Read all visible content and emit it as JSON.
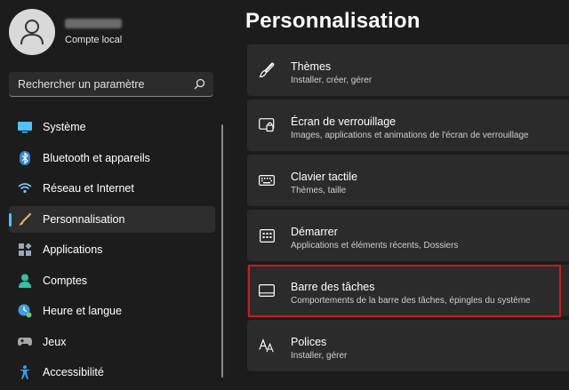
{
  "account": {
    "type": "Compte local"
  },
  "search": {
    "placeholder": "Rechercher un paramètre"
  },
  "nav": [
    {
      "label": "Système",
      "icon": "monitor-icon",
      "color": "#4cc2ff"
    },
    {
      "label": "Bluetooth et appareils",
      "icon": "bluetooth-icon",
      "color": "#2b88d8"
    },
    {
      "label": "Réseau et Internet",
      "icon": "wifi-icon",
      "color": "#7fc6f2"
    },
    {
      "label": "Personnalisation",
      "icon": "brush-icon",
      "color": "#f2a65a",
      "active": true
    },
    {
      "label": "Applications",
      "icon": "apps-icon",
      "color": "#9aa7b8"
    },
    {
      "label": "Comptes",
      "icon": "accounts-icon",
      "color": "#2ec4a5"
    },
    {
      "label": "Heure et langue",
      "icon": "clock-globe-icon",
      "color": "#3b9de6"
    },
    {
      "label": "Jeux",
      "icon": "gamepad-icon",
      "color": "#a8a8a8"
    },
    {
      "label": "Accessibilité",
      "icon": "accessibility-icon",
      "color": "#3aa0e8"
    }
  ],
  "page": {
    "title": "Personnalisation"
  },
  "cards": [
    {
      "title": "Thèmes",
      "subtitle": "Installer, créer, gérer",
      "icon": "brush-icon"
    },
    {
      "title": "Écran de verrouillage",
      "subtitle": "Images, applications et animations de l'écran de verrouillage",
      "icon": "lock-screen-icon"
    },
    {
      "title": "Clavier tactile",
      "subtitle": "Thèmes, taille",
      "icon": "keyboard-icon"
    },
    {
      "title": "Démarrer",
      "subtitle": "Applications et éléments récents, Dossiers",
      "icon": "start-icon"
    },
    {
      "title": "Barre des tâches",
      "subtitle": "Comportements de la barre des tâches, épingles du système",
      "icon": "taskbar-icon",
      "highlighted": true
    },
    {
      "title": "Polices",
      "subtitle": "Installer, gérer",
      "icon": "fonts-icon"
    }
  ],
  "colors": {
    "accent": "#4cc2ff",
    "highlight_border": "#d0191d"
  }
}
